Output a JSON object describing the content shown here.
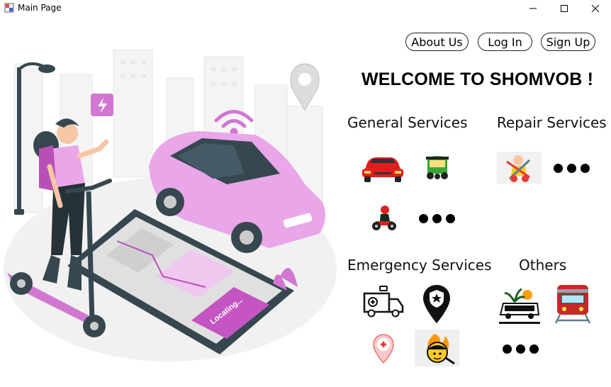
{
  "window": {
    "title": "Main Page"
  },
  "nav": {
    "about": "About Us",
    "login": "Log In",
    "signup": "Sign Up"
  },
  "welcome": "WELCOME TO SHOMVOB !",
  "sections": {
    "general": "General Services",
    "repair": "Repair Services",
    "emergency": "Emergency Services",
    "others": "Others"
  },
  "illustration": {
    "screen_text": "Locating..."
  },
  "colors": {
    "accent": "#e28ee0",
    "accent_dark": "#b84fb6",
    "car_red": "#e01e1e",
    "tuk_green": "#3aa735",
    "dark": "#37474f"
  }
}
